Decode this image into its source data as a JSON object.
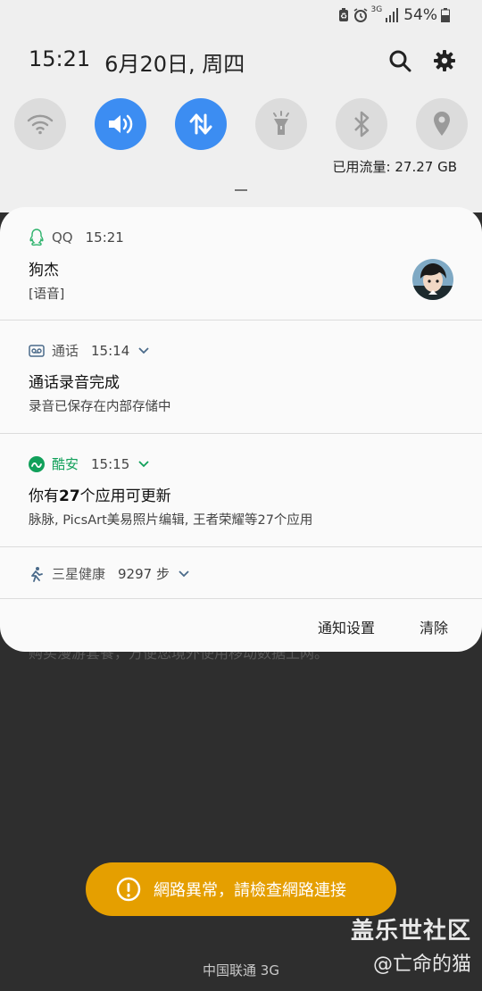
{
  "status_bar": {
    "network": "3G",
    "battery": "54%"
  },
  "header": {
    "time": "15:21",
    "date": "6月20日, 周四",
    "icons": [
      "search-icon",
      "gear-icon"
    ]
  },
  "quick_settings": [
    {
      "name": "wifi",
      "icon": "wifi-icon",
      "active": false
    },
    {
      "name": "sound",
      "icon": "volume-icon",
      "active": true
    },
    {
      "name": "mobile-data",
      "icon": "data-arrows-icon",
      "active": true
    },
    {
      "name": "flashlight",
      "icon": "flashlight-icon",
      "active": false
    },
    {
      "name": "bluetooth",
      "icon": "bluetooth-icon",
      "active": false
    },
    {
      "name": "location",
      "icon": "location-icon",
      "active": false
    }
  ],
  "data_usage": "已用流量: 27.27 GB",
  "notifications": [
    {
      "app": "QQ",
      "time": "15:21",
      "title": "狗杰",
      "body": "[语音]",
      "icon": "qq-icon",
      "accent": "#2fb36d"
    },
    {
      "app": "通话",
      "time": "15:14",
      "title": "通话录音完成",
      "body": "录音已保存在内部存储中",
      "icon": "recorder-icon",
      "accent": "#4a6a8a"
    },
    {
      "app": "酷安",
      "time": "15:15",
      "title_prefix": "你有",
      "title_number": "27",
      "title_suffix": "个应用可更新",
      "body": "脉脉, PicsArt美易照片编辑, 王者荣耀等27个应用",
      "icon": "coolapk-icon",
      "accent": "#11a05a"
    },
    {
      "app": "三星健康",
      "steps": "9297 步",
      "icon": "samsung-health-icon",
      "accent": "#4a6a8a"
    }
  ],
  "actions": {
    "settings_label": "通知设置",
    "clear_label": "清除"
  },
  "behind_text": "购买漫游套餐，方便您境外使用移动数据上网。",
  "toast": {
    "text": "網路異常，請檢查網路連接",
    "color": "#e59f00",
    "icon": "alert-icon"
  },
  "watermark": {
    "line1": "盖乐世社区",
    "line2": "@亡命的猫"
  },
  "carrier": "中国联通 3G"
}
